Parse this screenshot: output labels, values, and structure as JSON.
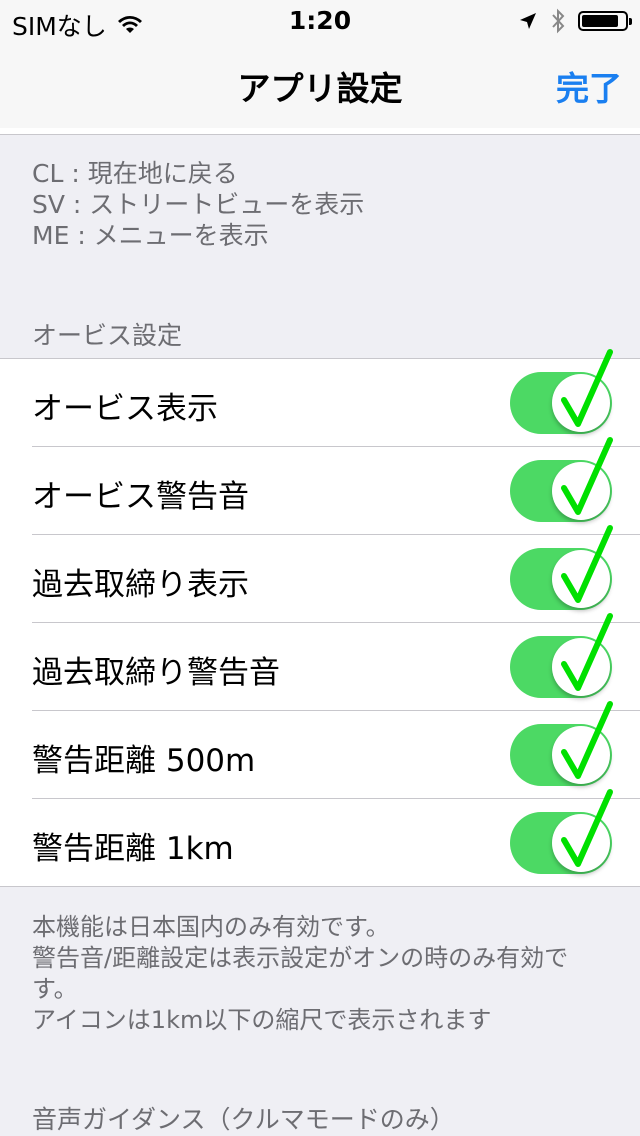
{
  "status": {
    "carrier": "SIMなし",
    "time": "1:20",
    "battery_level": 0.85
  },
  "nav": {
    "title": "アプリ設定",
    "done_label": "完了"
  },
  "legend": [
    "CL : 現在地に戻る",
    "SV : ストリートビューを表示",
    "ME : メニューを表示"
  ],
  "orbis_section": {
    "header": "オービス設定",
    "rows": [
      {
        "label": "オービス表示",
        "on": true
      },
      {
        "label": "オービス警告音",
        "on": true
      },
      {
        "label": "過去取締り表示",
        "on": true
      },
      {
        "label": "過去取締り警告音",
        "on": true
      },
      {
        "label": "警告距離 500m",
        "on": true
      },
      {
        "label": "警告距離 1km",
        "on": true
      }
    ],
    "footer": [
      "本機能は日本国内のみ有効です。",
      "警告音/距離設定は表示設定がオンの時のみ有効で",
      "す。",
      "アイコンは1km以下の縮尺で表示されます"
    ]
  },
  "voice_section": {
    "header": "音声ガイダンス（クルマモードのみ）"
  },
  "colors": {
    "accent": "#1a7ff0",
    "toggle_on": "#4cd964",
    "check": "#00e000"
  }
}
